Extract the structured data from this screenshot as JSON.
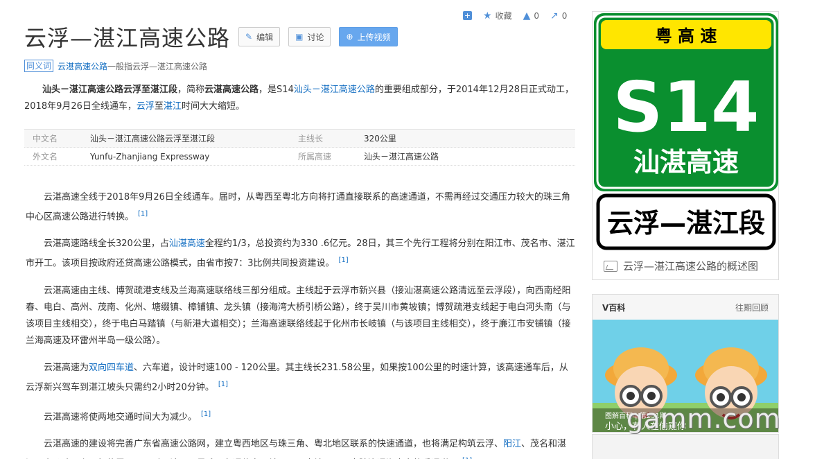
{
  "topbar": {
    "collect_label": "收藏",
    "like_count": "0",
    "share_count": "0"
  },
  "header": {
    "title": "云浮—湛江高速公路",
    "edit_label": "编辑",
    "discuss_label": "讨论",
    "upload_label": "上传视频"
  },
  "synonym": {
    "tag": "同义词",
    "link": "云湛高速公路",
    "text": "一般指云浮—湛江高速公路"
  },
  "intro": {
    "bold1": "汕头－湛江高速公路云浮至湛江段",
    "t1": "，简称",
    "bold2": "云湛高速公路",
    "t2": "，是S14",
    "link1": "汕头－湛江高速公路",
    "t3": "的重要组成部分，于2014年12月28日正式动工， 2018年9月26日全线通车，",
    "link2": "云浮",
    "t4": "至",
    "link3": "湛江",
    "t5": "时间大大缩短。"
  },
  "infobox": {
    "rows": [
      {
        "k1": "中文名",
        "v1": "汕头－湛江高速公路云浮至湛江段",
        "k2": "主线长",
        "v2": "320公里"
      },
      {
        "k1": "外文名",
        "v1": "Yunfu-Zhanjiang Expressway",
        "k2": "所属高速",
        "v2": "汕头－湛江高速公路"
      }
    ]
  },
  "paragraphs": {
    "p1": "云湛高速全线于2018年9月26日全线通车。届时，从粤西至粤北方向将打通直接联系的高速通道，不需再经过交通压力较大的珠三角中心区高速公路进行转换。",
    "p2a": "云湛高速路线全长320公里，占",
    "p2link": "汕湛高速",
    "p2b": "全程约1/3，总投资约为330 .6亿元。28日，其三个先行工程将分别在阳江市、茂名市、湛江市开工。该项目按政府还贷高速公路模式，由省市按7：3比例共同投资建设。",
    "p3": "云湛高速由主线、博贺疏港支线及兰海高速联络线三部分组成。主线起于云浮市新兴县（接汕湛高速公路清远至云浮段），向西南经阳春、电白、高州、茂南、化州、塘缀镇、樟铺镇、龙头镇（接海湾大桥引桥公路），终于吴川市黄坡镇；博贺疏港支线起于电白河头南（与该项目主线相交），终于电白马踏镇（与新港大道相交）；兰海高速联络线起于化州市长岐镇（与该项目主线相交），终于廉江市安铺镇（接兰海高速及环雷州半岛一级公路）。",
    "p4a": "云湛高速为",
    "p4link": "双向四车道",
    "p4b": "、六车道，设计时速100 - 120公里。其主线长231.58公里，如果按100公里的时速计算，该高速通车后，从云浮新兴驾车到湛江坡头只需约2小时20分钟。",
    "p5": "云湛高速将使两地交通时间大为减少。",
    "p6a": "云湛高速的建设将完善广东省高速公路网，建立粤西地区与珠三角、粤北地区联系的快速通道，也将满足构筑云浮、",
    "p6link": "阳江",
    "p6b": "、茂名和湛江四市公路网主骨架的需要。同时，该项目是珠三角通往粤西地区、西南地区以及大陆连通海南岛的重通道。",
    "ref": "[1]"
  },
  "sign": {
    "province": "粤 高 速",
    "code": "S14",
    "name": "汕湛高速",
    "section": "云浮—湛江段",
    "colors": {
      "green": "#0a8f2f",
      "yellow": "#ffe600"
    }
  },
  "sidebar": {
    "caption": "云浮—湛江高速公路的概述图",
    "vbaike_title": "V百科",
    "vbaike_more": "往期回顾",
    "vbaike_sub": "图解百科 | 第251期",
    "vbaike_line": "小心，有人在偷窥你",
    "watermark": "gamm.com"
  }
}
